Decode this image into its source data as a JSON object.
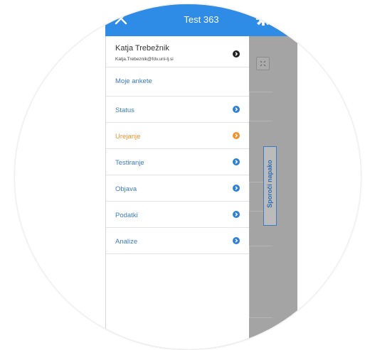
{
  "header": {
    "title": "Test 363"
  },
  "user": {
    "name": "Katja Trebežnik",
    "email": "Katja.Trebeznik@fdv.uni-lj.si"
  },
  "menu": [
    {
      "label": "Moje ankete"
    },
    {
      "label": "Status"
    },
    {
      "label": "Urejanje",
      "active": true
    },
    {
      "label": "Testiranje"
    },
    {
      "label": "Objava"
    },
    {
      "label": "Podatki"
    },
    {
      "label": "Analize"
    }
  ],
  "feedback_tab": {
    "label": "Sporoči napako"
  },
  "colors": {
    "header": "#2e8be6",
    "link": "#3b7cc4",
    "active": "#f0932b",
    "overlay": "#a4a4a4"
  },
  "icons": {
    "close": "close-icon",
    "settings": "gear-icon",
    "user_arrow": "chevron-right-icon",
    "menu_arrow": "chevron-right-icon",
    "expand": "expand-icon"
  }
}
